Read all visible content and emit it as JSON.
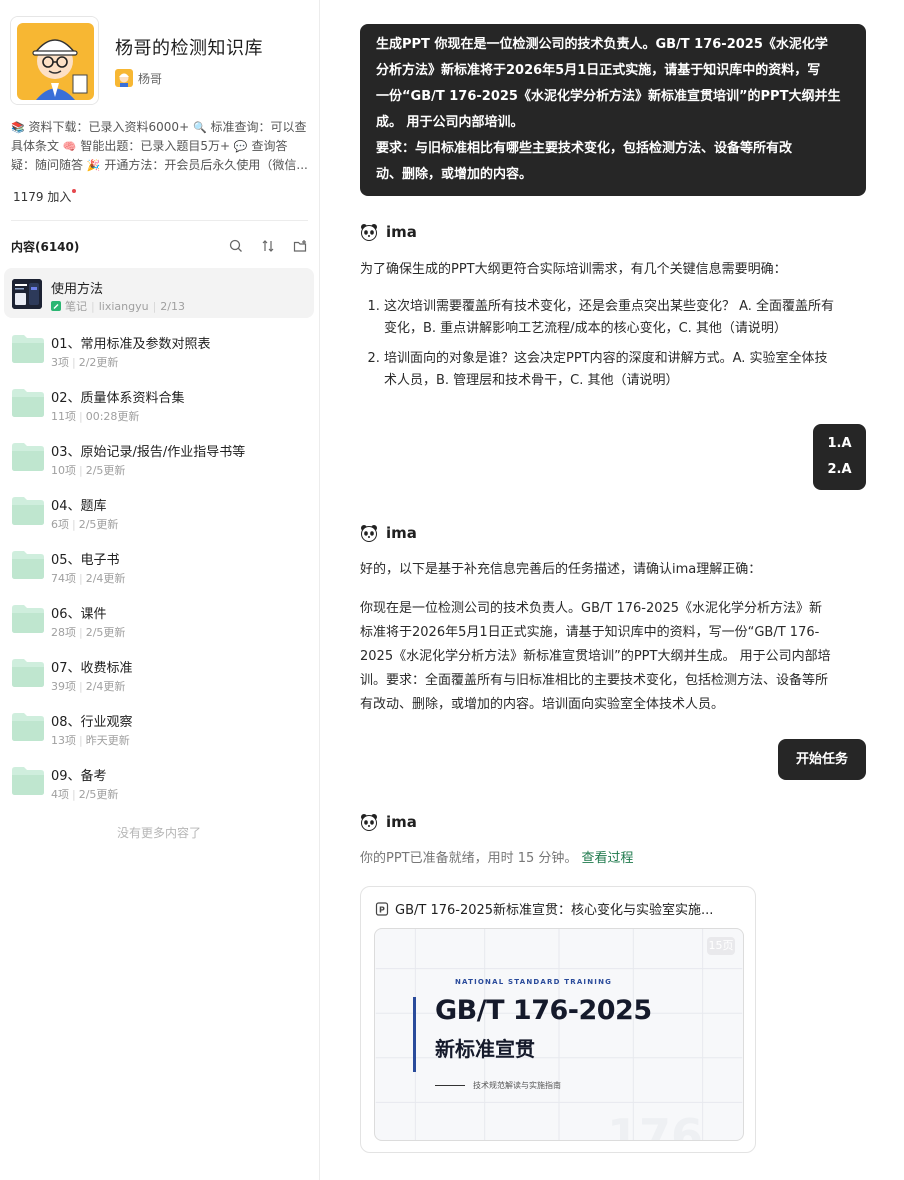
{
  "sidebar": {
    "kb_title": "杨哥的检测知识库",
    "owner_name": "杨哥",
    "description": {
      "seg1": "资料下载：已录入资料6000+",
      "seg2": "标准查询：可以查具体条文",
      "seg3": "智能出题：已录入题目5万+",
      "seg4": "查询答疑：随问随答",
      "seg5": "开通方法：开会员后永久使用（微信..."
    },
    "joined": "1179 加入",
    "content_label": "内容(6140)",
    "note": {
      "title": "使用方法",
      "type": "笔记",
      "author": "lixiangyu",
      "date": "2/13"
    },
    "folders": [
      {
        "title": "01、常用标准及参数对照表",
        "count": "3项",
        "updated": "2/2更新"
      },
      {
        "title": "02、质量体系资料合集",
        "count": "11项",
        "updated": "00:28更新"
      },
      {
        "title": "03、原始记录/报告/作业指导书等",
        "count": "10项",
        "updated": "2/5更新"
      },
      {
        "title": "04、题库",
        "count": "6项",
        "updated": "2/5更新"
      },
      {
        "title": "05、电子书",
        "count": "74项",
        "updated": "2/4更新"
      },
      {
        "title": "06、课件",
        "count": "28项",
        "updated": "2/5更新"
      },
      {
        "title": "07、收费标准",
        "count": "39项",
        "updated": "2/4更新"
      },
      {
        "title": "08、行业观察",
        "count": "13项",
        "updated": "昨天更新"
      },
      {
        "title": "09、备考",
        "count": "4项",
        "updated": "2/5更新"
      }
    ],
    "no_more": "没有更多内容了"
  },
  "chat": {
    "user_msg1": {
      "line1": "生成PPT  你现在是一位检测公司的技术负责人。GB/T 176-2025《水泥化学",
      "line2": "分析方法》新标准将于2026年5月1日正式实施，请基于知识库中的资料，写",
      "line3": "一份“GB/T 176-2025《水泥化学分析方法》新标准宣贯培训”的PPT大纲并生",
      "line4": "成。 用于公司内部培训。",
      "line5": "要求：与旧标准相比有哪些主要技术变化，包括检测方法、设备等所有改",
      "line6": "动、删除，或增加的内容。"
    },
    "assistant_name": "ima",
    "reply1_intro": "为了确保生成的PPT大纲更符合实际培训需求，有几个关键信息需要明确：",
    "reply1_q1_l1": "这次培训需要覆盖所有技术变化，还是会重点突出某些变化？ A. 全面覆盖所有",
    "reply1_q1_l2": "变化，B. 重点讲解影响工艺流程/成本的核心变化，C. 其他（请说明）",
    "reply1_q2_l1": "培训面向的对象是谁？这会决定PPT内容的深度和讲解方式。A. 实验室全体技",
    "reply1_q2_l2": "术人员，B. 管理层和技术骨干，C. 其他（请说明）",
    "user_msg2_l1": "1.A",
    "user_msg2_l2": "2.A",
    "reply2_intro": "好的，以下是基于补充信息完善后的任务描述，请确认ima理解正确：",
    "reply2_l1": "你现在是一位检测公司的技术负责人。GB/T 176-2025《水泥化学分析方法》新",
    "reply2_l2": "标准将于2026年5月1日正式实施，请基于知识库中的资料，写一份“GB/T 176-",
    "reply2_l3": "2025《水泥化学分析方法》新标准宣贯培训”的PPT大纲并生成。 用于公司内部培",
    "reply2_l4": "训。要求：全面覆盖所有与旧标准相比的主要技术变化，包括检测方法、设备等所",
    "reply2_l5": "有改动、删除，或增加的内容。培训面向实验室全体技术人员。",
    "start_button": "开始任务",
    "ready_text": "你的PPT已准备就绪，用时 15 分钟。",
    "view_process": "查看过程",
    "ppt_card_title": "GB/T 176-2025新标准宣贯：核心变化与实验室实施...",
    "slide": {
      "badge": "15页",
      "kicker": "NATIONAL STANDARD TRAINING",
      "title": "GB/T 176-2025",
      "subtitle": "新标准宣贯",
      "tagline": "技术规范解读与实施指南",
      "bg_number": "176"
    }
  },
  "colors": {
    "dark_bubble": "#262626",
    "link_green": "#1f7a4d",
    "folder_green": "#bfe6cf",
    "slide_blue": "#2a4b9b"
  }
}
